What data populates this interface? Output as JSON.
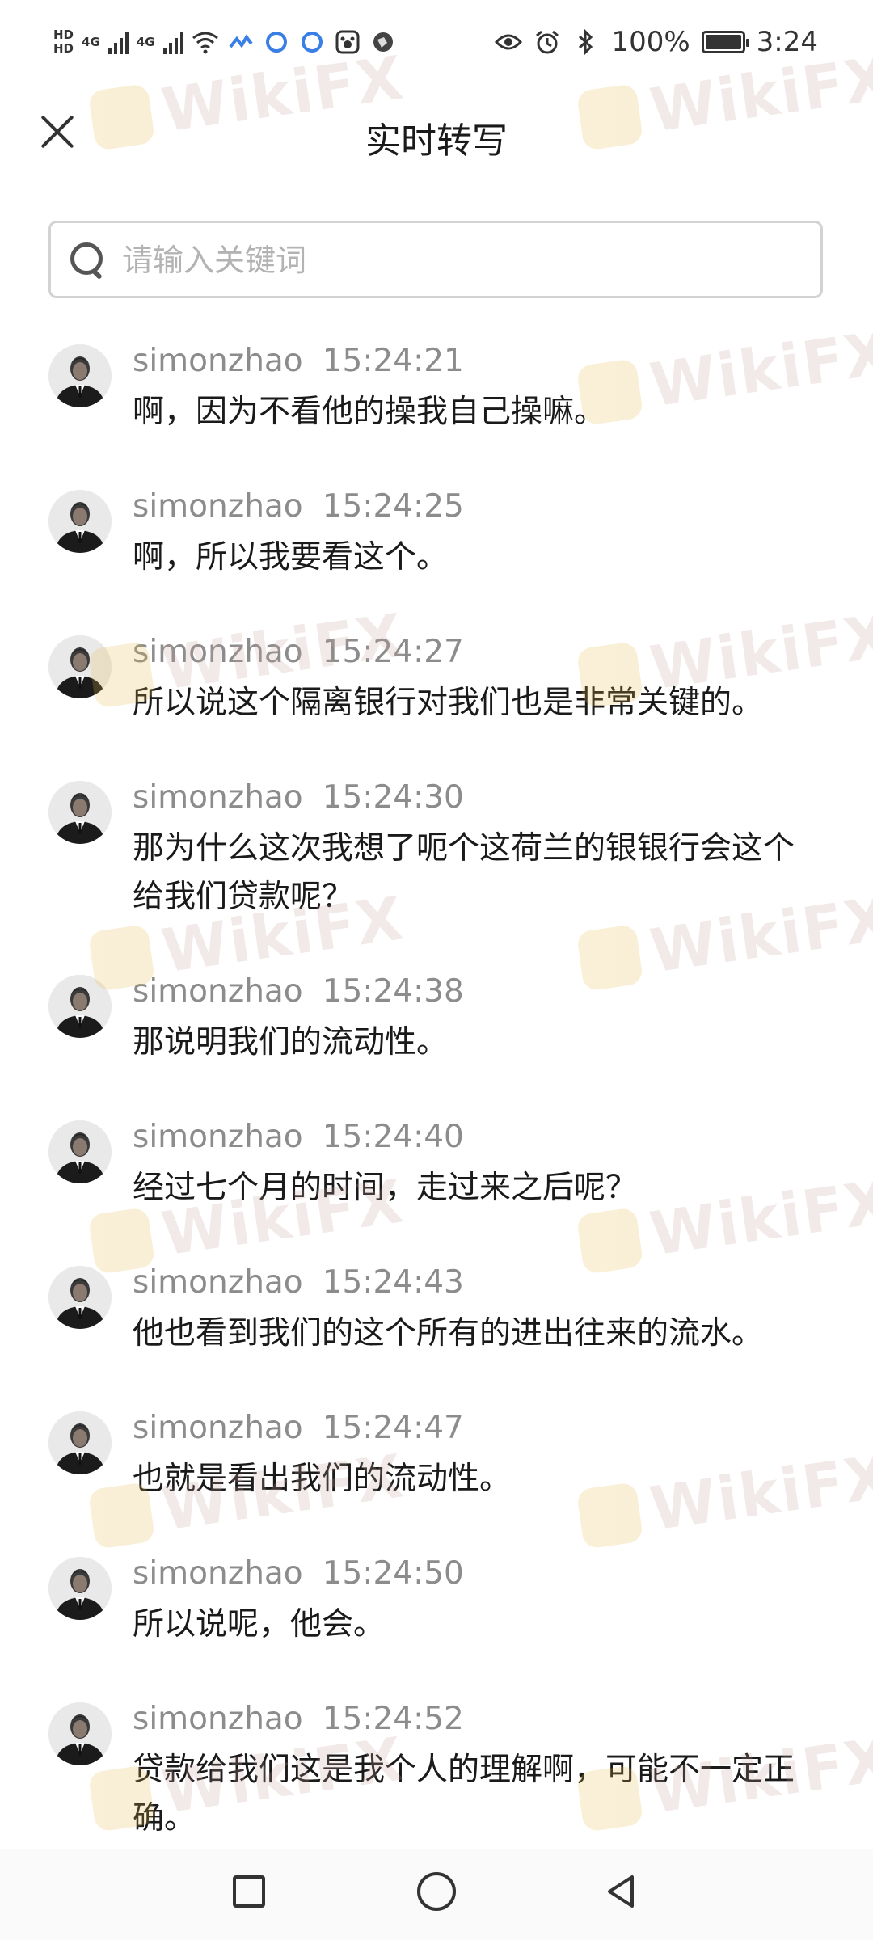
{
  "status_bar": {
    "left_labels": [
      "HD",
      "4G",
      "4G"
    ],
    "battery_text": "100%",
    "battery_level": 1.0,
    "time": "3:24",
    "icons": [
      "signal-icon",
      "wifi-icon",
      "app-icon",
      "eye-icon",
      "alarm-icon",
      "bluetooth-icon",
      "battery-icon"
    ]
  },
  "header": {
    "title": "实时转写",
    "close_icon": "close-icon"
  },
  "search": {
    "placeholder": "请输入关键词",
    "value": ""
  },
  "watermark": "WikiFX",
  "messages": [
    {
      "user": "simonzhao",
      "time": "15:24:21",
      "text": "啊，因为不看他的操我自己操嘛。"
    },
    {
      "user": "simonzhao",
      "time": "15:24:25",
      "text": "啊，所以我要看这个。"
    },
    {
      "user": "simonzhao",
      "time": "15:24:27",
      "text": "所以说这个隔离银行对我们也是非常关键的。"
    },
    {
      "user": "simonzhao",
      "time": "15:24:30",
      "text": "那为什么这次我想了呃个这荷兰的银银行会这个给我们贷款呢？"
    },
    {
      "user": "simonzhao",
      "time": "15:24:38",
      "text": "那说明我们的流动性。"
    },
    {
      "user": "simonzhao",
      "time": "15:24:40",
      "text": "经过七个月的时间，走过来之后呢？"
    },
    {
      "user": "simonzhao",
      "time": "15:24:43",
      "text": "他也看到我们的这个所有的进出往来的流水。"
    },
    {
      "user": "simonzhao",
      "time": "15:24:47",
      "text": "也就是看出我们的流动性。"
    },
    {
      "user": "simonzhao",
      "time": "15:24:50",
      "text": "所以说呢，他会。"
    },
    {
      "user": "simonzhao",
      "time": "15:24:52",
      "text": "贷款给我们这是我个人的理解啊，可能不一定正确。"
    }
  ],
  "nav": {
    "recent_icon": "square-icon",
    "home_icon": "circle-icon",
    "back_icon": "triangle-back-icon"
  }
}
